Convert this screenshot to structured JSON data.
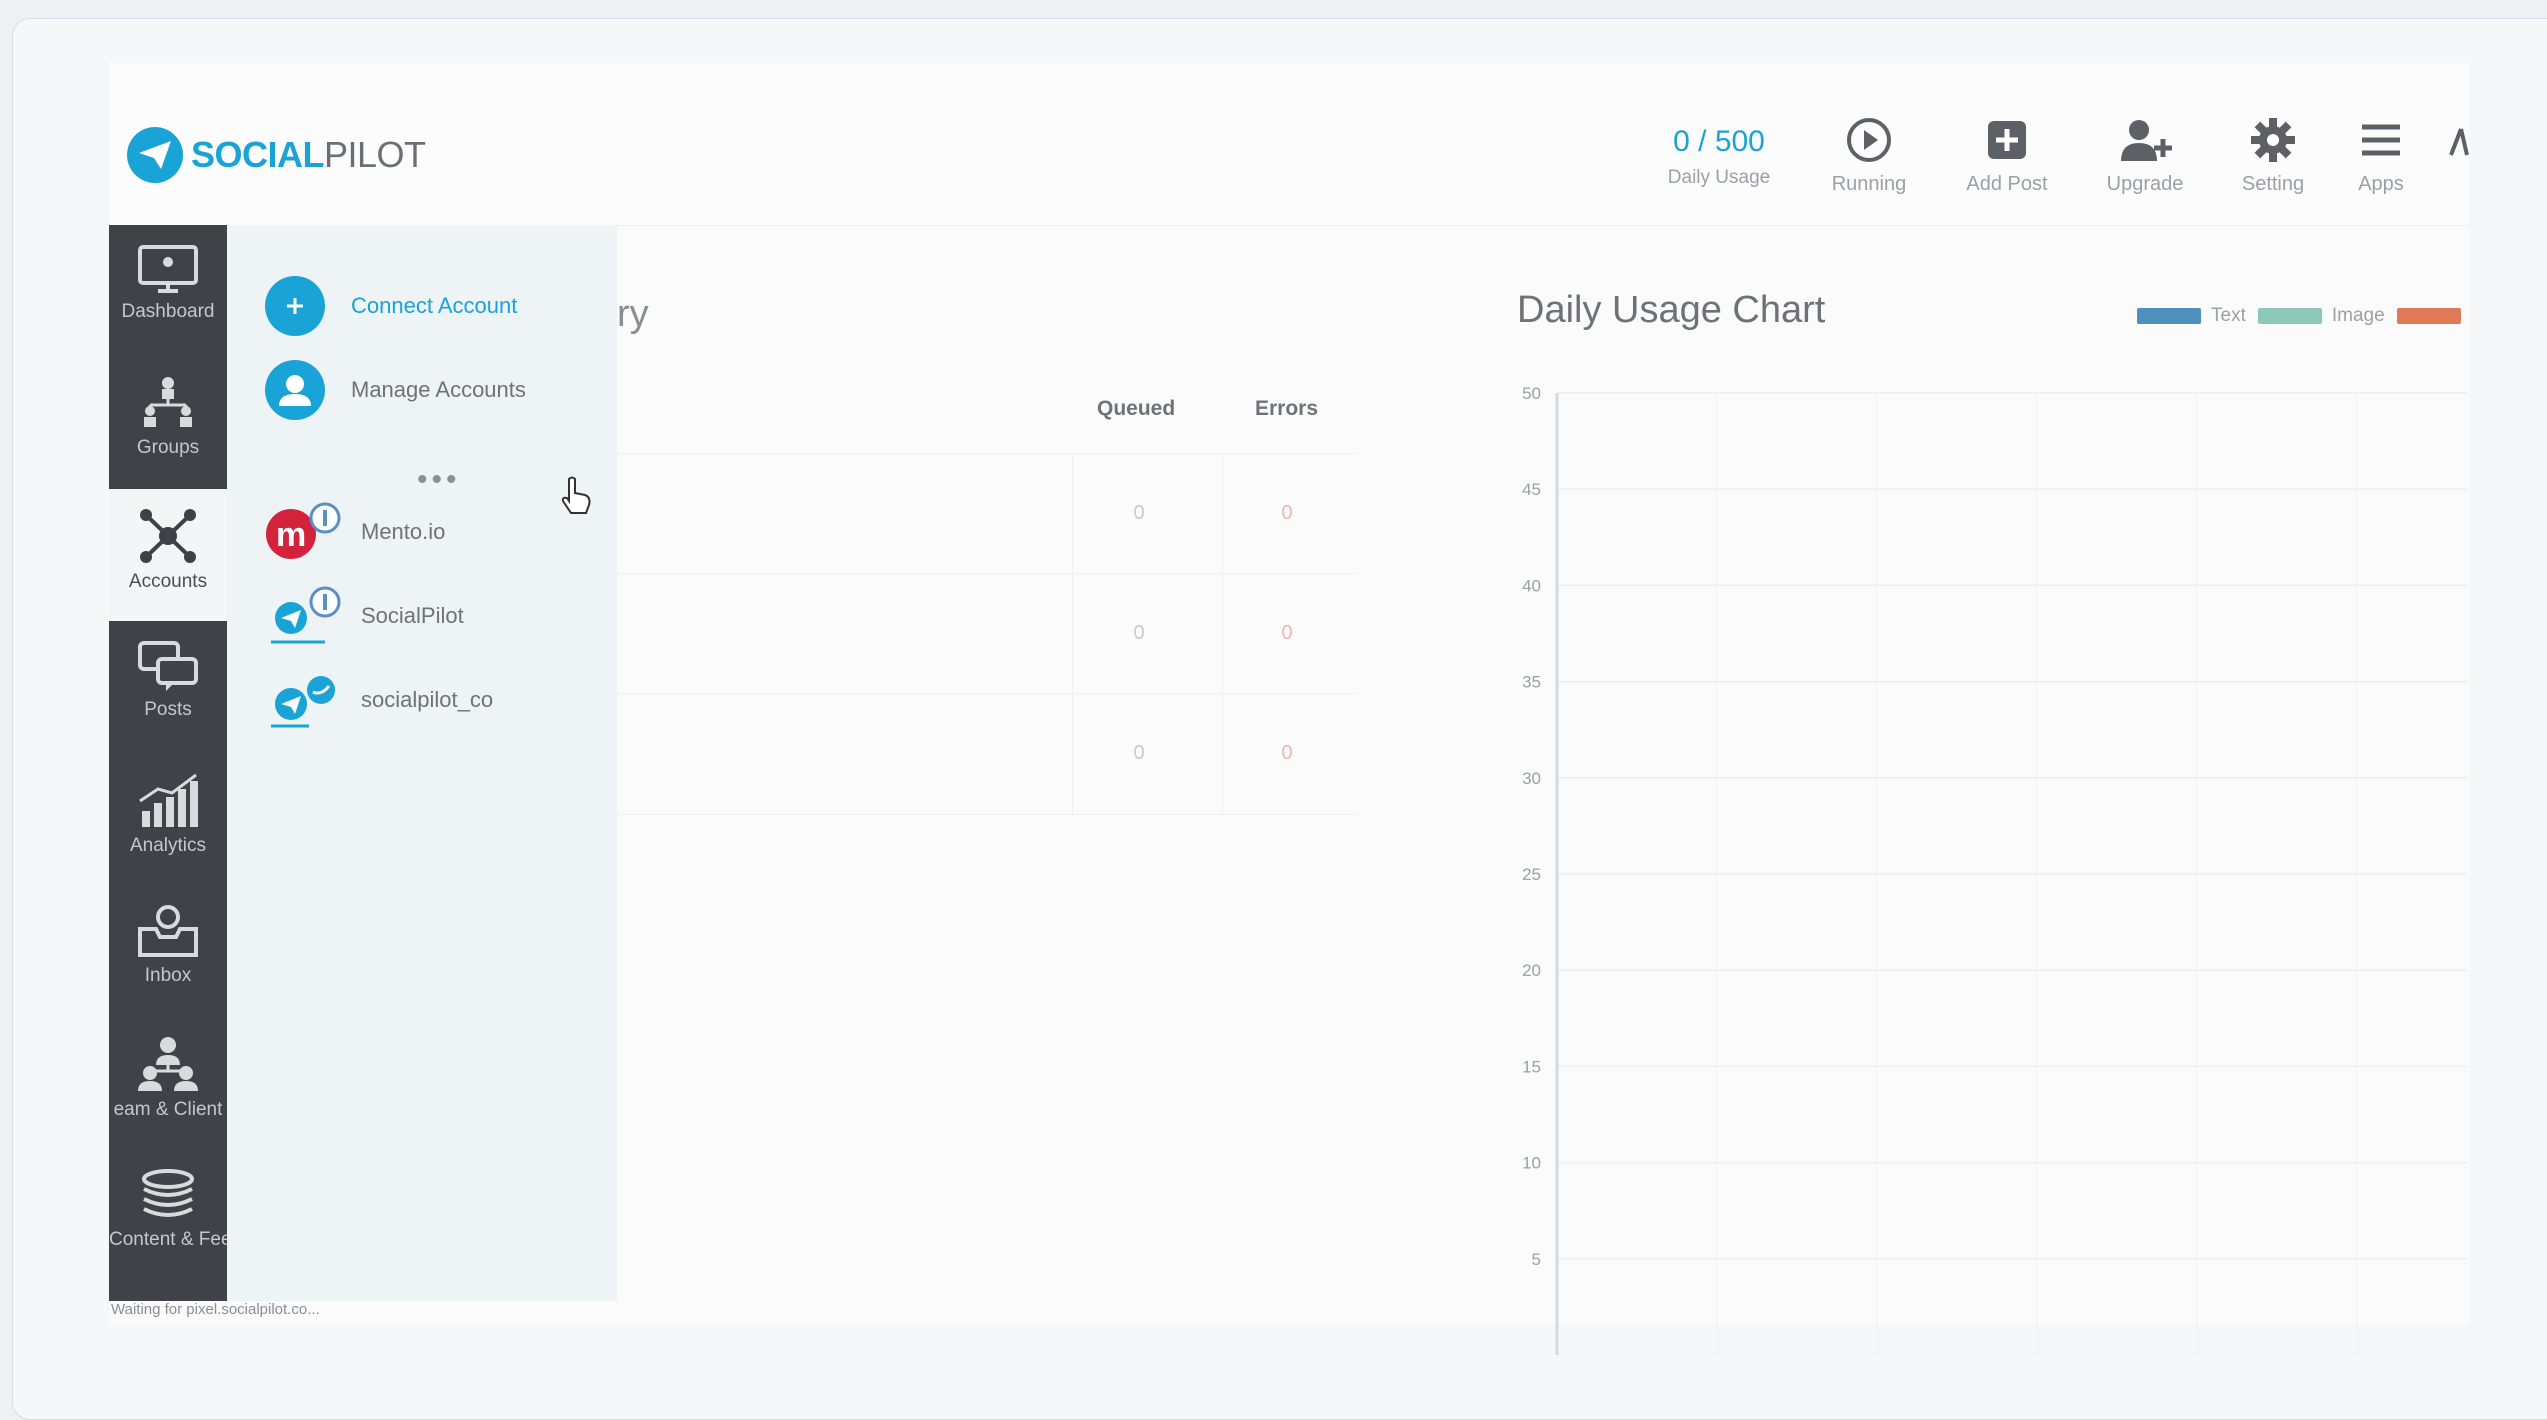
{
  "brand": {
    "name_bold": "SOCIAL",
    "name_light": "PILOT"
  },
  "header": {
    "usage": {
      "value": "0 / 500",
      "label": "Daily Usage"
    },
    "items": [
      {
        "label": "Running",
        "icon": "play-circle-icon"
      },
      {
        "label": "Add Post",
        "icon": "plus-square-icon"
      },
      {
        "label": "Upgrade",
        "icon": "user-plus-icon"
      },
      {
        "label": "Setting",
        "icon": "gear-icon"
      },
      {
        "label": "Apps",
        "icon": "menu-icon"
      }
    ]
  },
  "sidebar": {
    "items": [
      {
        "label": "Dashboard",
        "icon": "monitor-icon"
      },
      {
        "label": "Groups",
        "icon": "org-chart-icon"
      },
      {
        "label": "Accounts",
        "icon": "network-icon",
        "active": true
      },
      {
        "label": "Posts",
        "icon": "chat-bubbles-icon"
      },
      {
        "label": "Analytics",
        "icon": "bar-chart-icon"
      },
      {
        "label": "Inbox",
        "icon": "inbox-icon"
      },
      {
        "label": "eam & Client",
        "icon": "team-icon"
      },
      {
        "label": "Content & Feed",
        "icon": "stack-icon"
      }
    ]
  },
  "dropdown": {
    "connect_label": "Connect Account",
    "manage_label": "Manage Accounts",
    "dots": "•••",
    "accounts": [
      {
        "name": "Mento.io",
        "icon": "mento-logo-icon"
      },
      {
        "name": "SocialPilot",
        "icon": "socialpilot-account-icon"
      },
      {
        "name": "socialpilot_co",
        "icon": "socialpilot-twitter-icon"
      }
    ]
  },
  "summary": {
    "title_fragment": "ry",
    "columns": [
      "Queued",
      "Errors"
    ],
    "rows": [
      {
        "queued": "0",
        "errors": "0"
      },
      {
        "queued": "0",
        "errors": "0"
      },
      {
        "queued": "0",
        "errors": "0"
      }
    ]
  },
  "chart_data": {
    "type": "line",
    "title": "Daily Usage Chart",
    "legend": [
      "Text",
      "Image",
      ""
    ],
    "legend_colors": [
      "#4f8fbd",
      "#8cc8b6",
      "#e07a56"
    ],
    "legend_position": "top-right",
    "ylim": [
      0,
      50
    ],
    "y_ticks": [
      "50",
      "45",
      "40",
      "35",
      "30",
      "25",
      "20",
      "15",
      "10",
      "5"
    ],
    "grid": true,
    "series": []
  },
  "statusbar": {
    "text": "Waiting for pixel.socialpilot.co..."
  }
}
